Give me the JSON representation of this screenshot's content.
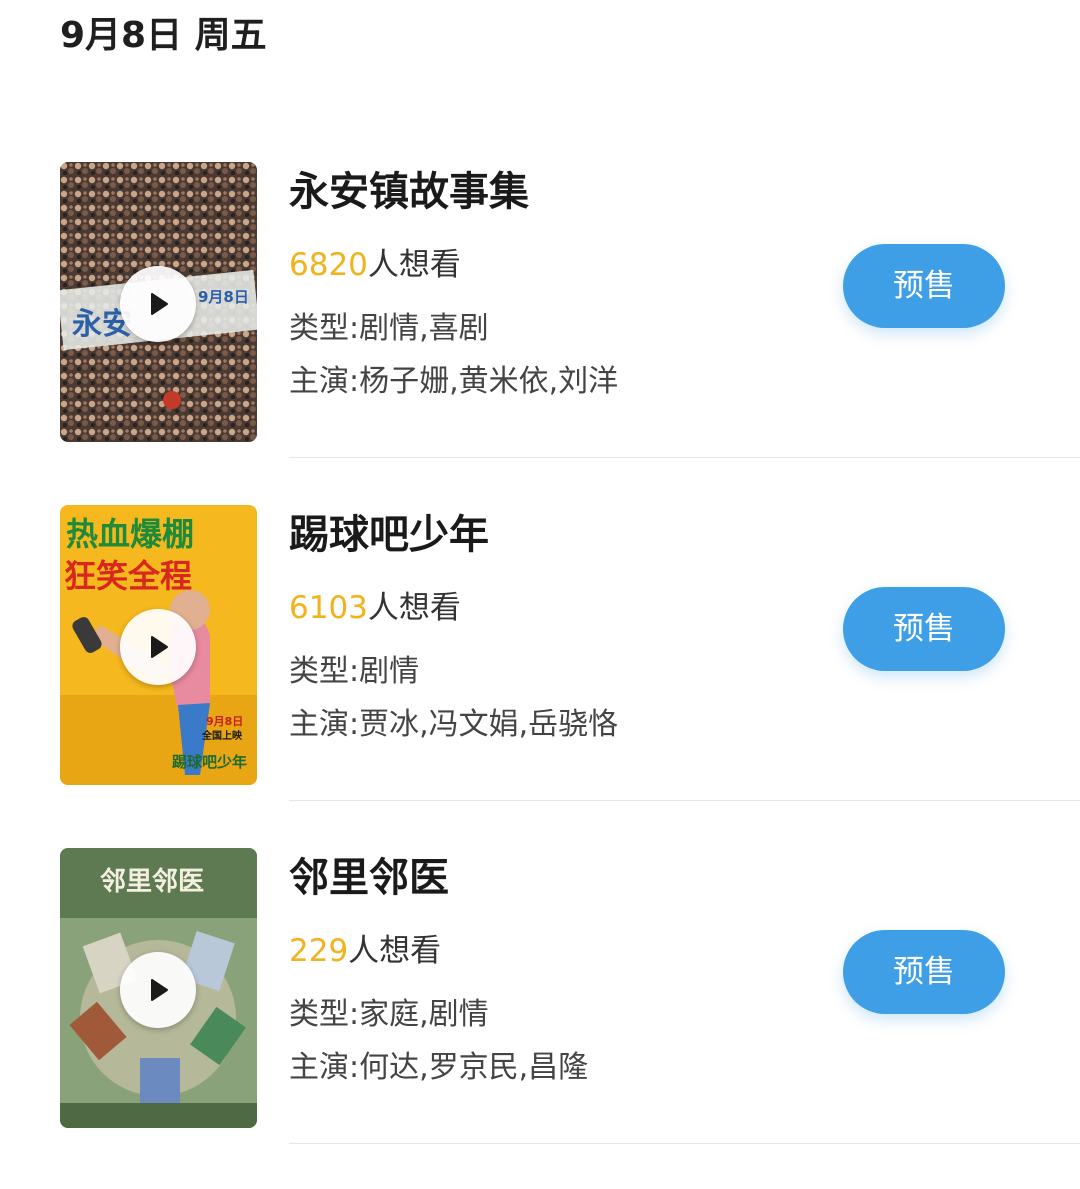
{
  "header": {
    "date": "9月8日",
    "weekday": "周五"
  },
  "movies": [
    {
      "title": "永安镇故事集",
      "want_count": "6820",
      "want_suffix": "人想看",
      "genre_label": "类型:",
      "genre": "剧情,喜剧",
      "cast_label": "主演:",
      "cast": "杨子姗,黄米依,刘洋",
      "button_label": "预售",
      "poster_text": [
        "9月8日",
        "永安"
      ]
    },
    {
      "title": "踢球吧少年",
      "want_count": "6103",
      "want_suffix": "人想看",
      "genre_label": "类型:",
      "genre": "剧情",
      "cast_label": "主演:",
      "cast": "贾冰,冯文娟,岳骁恪",
      "button_label": "预售",
      "poster_text": [
        "热血爆棚",
        "狂笑全程",
        "9月8日",
        "全国上映",
        "踢球吧少年"
      ]
    },
    {
      "title": "邻里邻医",
      "want_count": "229",
      "want_suffix": "人想看",
      "genre_label": "类型:",
      "genre": "家庭,剧情",
      "cast_label": "主演:",
      "cast": "何达,罗京民,昌隆",
      "button_label": "预售",
      "poster_text": [
        "邻里邻医"
      ]
    }
  ],
  "colors": {
    "accent_button": "#3f9fe6",
    "want_count": "#f2b21c"
  },
  "icons": {
    "play": "play-icon"
  }
}
